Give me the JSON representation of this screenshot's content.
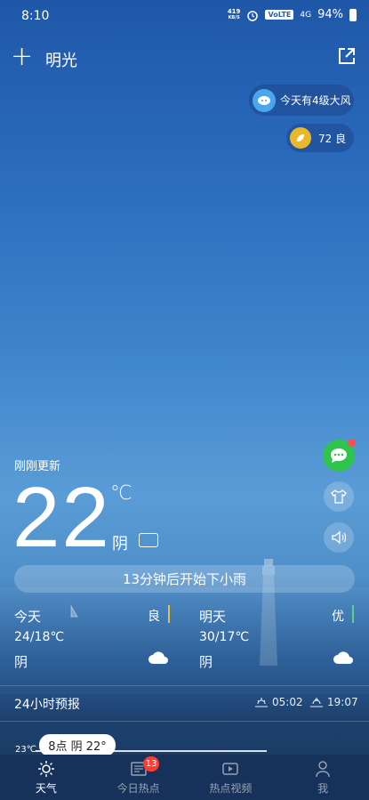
{
  "status_bar": {
    "time": "8:10",
    "net_speed": "419",
    "net_unit": "KB/S",
    "volte": "VoLTE",
    "signal": "4G",
    "battery": "94%"
  },
  "header": {
    "city": "明光"
  },
  "alerts": {
    "warning_text": "今天有4级大风",
    "aqi_text": "72 良"
  },
  "current": {
    "updated_label": "刚刚更新",
    "temperature": "22",
    "unit": "℃",
    "condition": "阴"
  },
  "rain_notice": "13分钟后开始下小雨",
  "days": [
    {
      "label": "今天",
      "quality": "良",
      "quality_color": "#e6c040",
      "temp_range": "24/18℃",
      "condition": "阴",
      "icon": "cloud-icon"
    },
    {
      "label": "明天",
      "quality": "优",
      "quality_color": "#5ed08a",
      "temp_range": "30/17℃",
      "condition": "阴",
      "icon": "cloud-icon"
    }
  ],
  "forecast": {
    "title": "24小时预报",
    "sunrise": "05:02",
    "sunset": "19:07",
    "start_temp": "23℃",
    "tooltip": "8点 阴 22°"
  },
  "nav": [
    {
      "label": "天气",
      "icon": "sun-icon",
      "active": true
    },
    {
      "label": "今日热点",
      "icon": "news-icon",
      "badge": "13"
    },
    {
      "label": "热点视频",
      "icon": "video-icon"
    },
    {
      "label": "我",
      "icon": "person-icon"
    }
  ]
}
